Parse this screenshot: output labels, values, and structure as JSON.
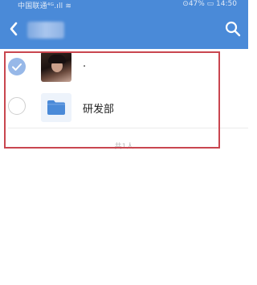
{
  "status_bar": {
    "carrier": "中国联通⁴ᴳ.ıll ≋",
    "right": "⊙47% ▭ 14:50"
  },
  "nav": {
    "back_icon": "chevron-left-icon",
    "search_icon": "search-icon"
  },
  "members": [
    {
      "name": "·",
      "type": "person",
      "selected": true
    },
    {
      "name": "研发部",
      "type": "folder",
      "selected": false
    }
  ],
  "footer_text": "共1人",
  "colors": {
    "nav": "#4a8ad8",
    "check": "#97b8e8",
    "highlight": "#c9464f"
  }
}
